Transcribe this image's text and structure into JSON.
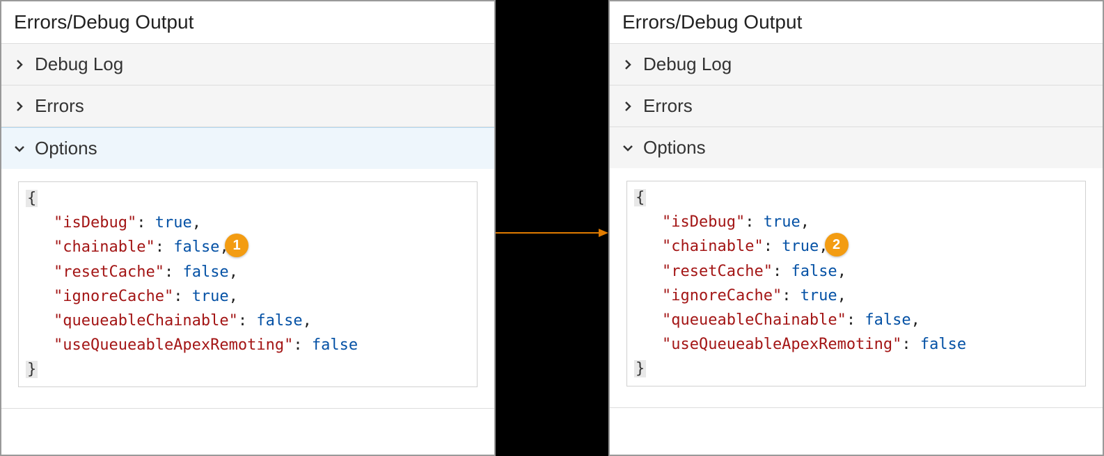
{
  "panels": [
    {
      "title": "Errors/Debug Output",
      "selectedSection": "options",
      "sections": [
        {
          "id": "debugLog",
          "label": "Debug Log",
          "expanded": false
        },
        {
          "id": "errors",
          "label": "Errors",
          "expanded": false
        },
        {
          "id": "options",
          "label": "Options",
          "expanded": true,
          "calloutNumber": "1",
          "json": {
            "isDebug": "true",
            "chainable": "false",
            "resetCache": "false",
            "ignoreCache": "true",
            "queueableChainable": "false",
            "useQueueableApexRemoting": "false"
          }
        }
      ]
    },
    {
      "title": "Errors/Debug Output",
      "selectedSection": null,
      "sections": [
        {
          "id": "debugLog",
          "label": "Debug Log",
          "expanded": false
        },
        {
          "id": "errors",
          "label": "Errors",
          "expanded": false
        },
        {
          "id": "options",
          "label": "Options",
          "expanded": true,
          "calloutNumber": "2",
          "json": {
            "isDebug": "true",
            "chainable": "true",
            "resetCache": "false",
            "ignoreCache": "true",
            "queueableChainable": "false",
            "useQueueableApexRemoting": "false"
          }
        }
      ]
    }
  ],
  "calloutLineKey": "chainable"
}
